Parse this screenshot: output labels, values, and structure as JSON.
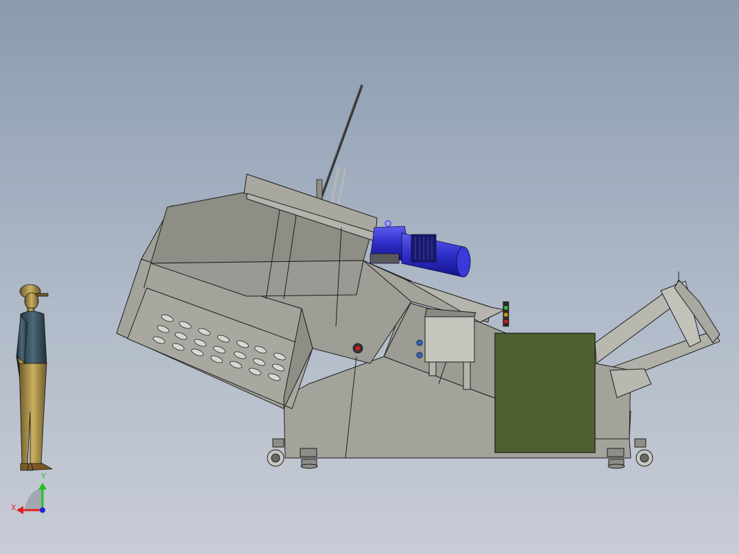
{
  "viewport": {
    "background_top": "#8a9bb0",
    "background_bottom": "#c8ccd6"
  },
  "colors": {
    "machine_body": "#a3a29b",
    "machine_body_dark": "#8e8d86",
    "motor_blue": "#2e2ec8",
    "control_cabinet": "#4f6030",
    "indicator_red": "#cc2020",
    "outline": "#1c1c1c"
  },
  "triad": {
    "x_label": "X",
    "y_label": "Y",
    "x_color": "#e02020",
    "y_color": "#20c020",
    "z_color": "#2020e0"
  },
  "components": [
    "human-scale-figure",
    "machine-main-body",
    "feed-hood",
    "inclined-rod",
    "electric-motor",
    "junction-box",
    "control-cabinet",
    "discharge-conveyor",
    "signal-tower",
    "caster-wheel"
  ]
}
